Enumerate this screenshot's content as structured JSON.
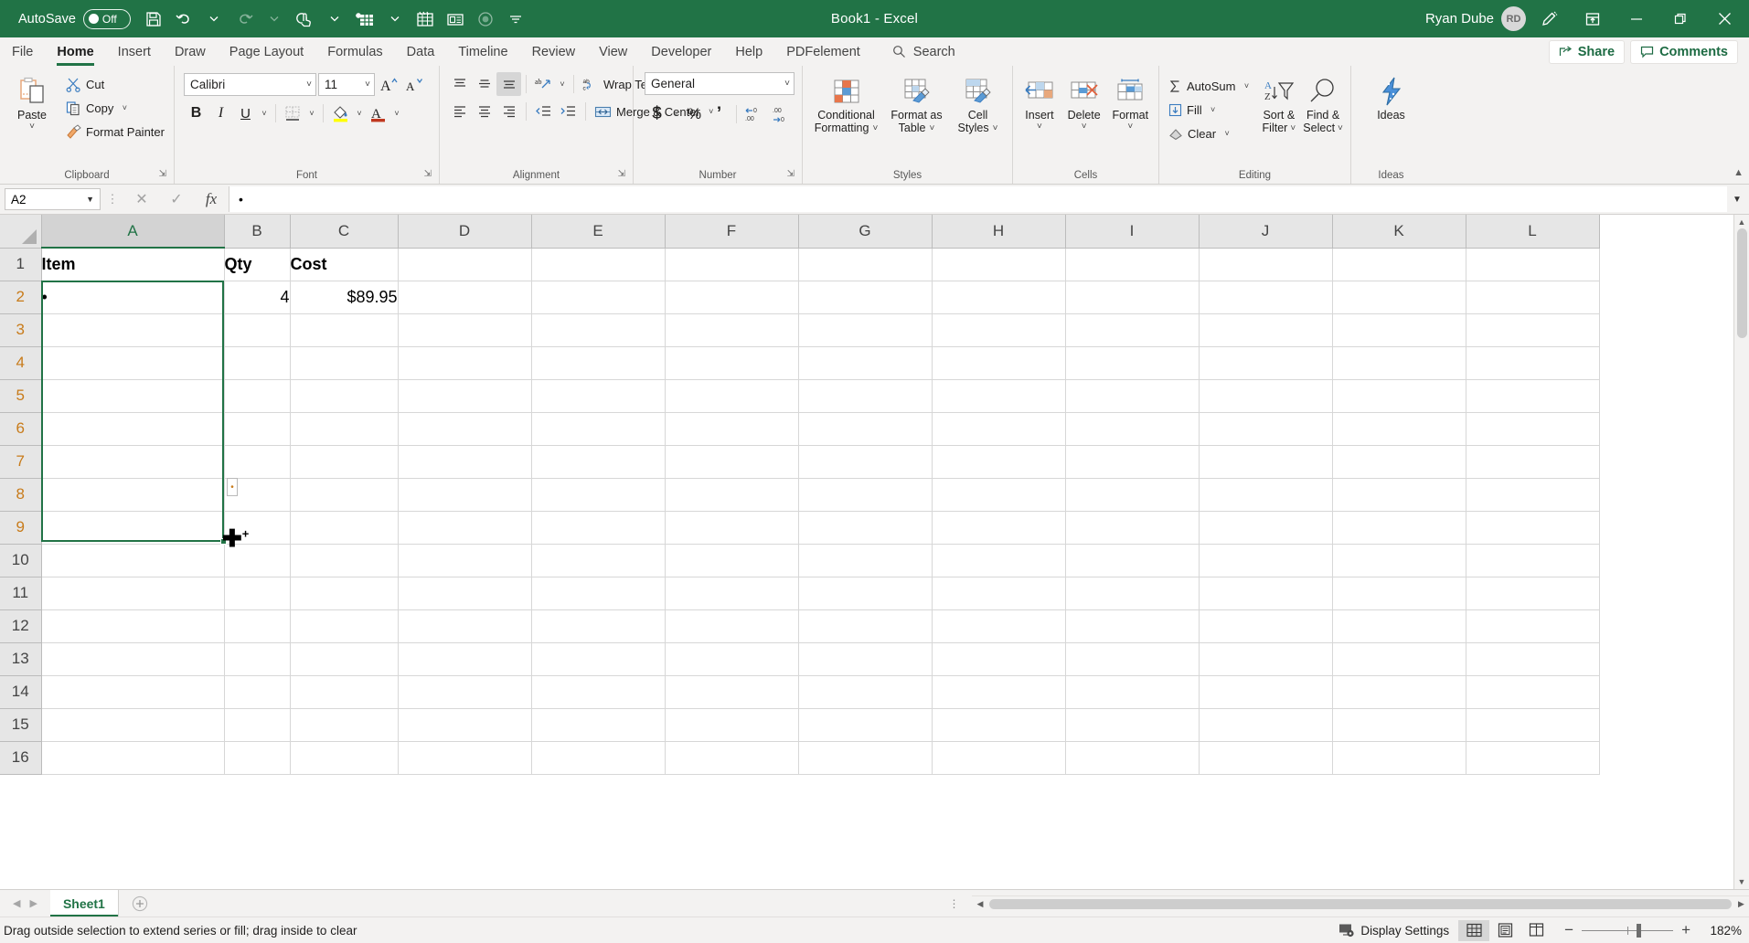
{
  "titlebar": {
    "autosave_label": "AutoSave",
    "autosave_state": "Off",
    "window_title": "Book1  -  Excel",
    "user_name": "Ryan Dube",
    "avatar_initials": "RD",
    "qat": [
      {
        "name": "save-icon",
        "label": "Save"
      },
      {
        "name": "undo-icon",
        "label": "Undo"
      },
      {
        "name": "redo-icon",
        "label": "Redo"
      },
      {
        "name": "touch-mode-icon",
        "label": "Touch/Mouse Mode"
      },
      {
        "name": "new-table-icon",
        "label": "Insert Table"
      },
      {
        "name": "spreadsheet-icon",
        "label": "Sheet Tools"
      },
      {
        "name": "form-icon",
        "label": "Form"
      },
      {
        "name": "record-icon",
        "label": "Record Macro"
      },
      {
        "name": "customize-qat-icon",
        "label": "Customize Quick Access Toolbar"
      }
    ],
    "window_controls": [
      "minimize",
      "restore",
      "close"
    ]
  },
  "tabs": {
    "items": [
      {
        "label": "File",
        "active": false
      },
      {
        "label": "Home",
        "active": true
      },
      {
        "label": "Insert",
        "active": false
      },
      {
        "label": "Draw",
        "active": false
      },
      {
        "label": "Page Layout",
        "active": false
      },
      {
        "label": "Formulas",
        "active": false
      },
      {
        "label": "Data",
        "active": false
      },
      {
        "label": "Timeline",
        "active": false
      },
      {
        "label": "Review",
        "active": false
      },
      {
        "label": "View",
        "active": false
      },
      {
        "label": "Developer",
        "active": false
      },
      {
        "label": "Help",
        "active": false
      },
      {
        "label": "PDFelement",
        "active": false
      }
    ],
    "search_placeholder": "Search",
    "share_label": "Share",
    "comments_label": "Comments"
  },
  "ribbon": {
    "clipboard": {
      "label": "Clipboard",
      "paste_label": "Paste",
      "cut_label": "Cut",
      "copy_label": "Copy",
      "format_painter_label": "Format Painter"
    },
    "font": {
      "label": "Font",
      "font_name": "Calibri",
      "font_size": "11",
      "grow_label": "A",
      "shrink_label": "A",
      "bold_label": "B",
      "italic_label": "I",
      "underline_label": "U"
    },
    "alignment": {
      "label": "Alignment",
      "wrap_text_label": "Wrap Text",
      "merge_center_label": "Merge & Center"
    },
    "number": {
      "label": "Number",
      "format": "General",
      "currency_label": "$",
      "percent_label": "%",
      "comma_label": "’"
    },
    "styles": {
      "label": "Styles",
      "conditional_formatting_label": "Conditional\nFormatting",
      "conditional_formatting_l1": "Conditional",
      "conditional_formatting_l2": "Formatting",
      "format_as_table_l1": "Format as",
      "format_as_table_l2": "Table",
      "cell_styles_l1": "Cell",
      "cell_styles_l2": "Styles"
    },
    "cells": {
      "label": "Cells",
      "insert_label": "Insert",
      "delete_label": "Delete",
      "format_label": "Format"
    },
    "editing": {
      "label": "Editing",
      "autosum_label": "AutoSum",
      "fill_label": "Fill",
      "clear_label": "Clear",
      "sort_filter_l1": "Sort &",
      "sort_filter_l2": "Filter",
      "find_select_l1": "Find &",
      "find_select_l2": "Select"
    },
    "ideas": {
      "label": "Ideas",
      "button_label": "Ideas"
    }
  },
  "formula_bar": {
    "name_box": "A2",
    "formula_value": "•",
    "cancel_icon": "✕",
    "enter_icon": "✓",
    "function_icon": "fx"
  },
  "grid": {
    "columns": [
      "A",
      "B",
      "C",
      "D",
      "E",
      "F",
      "G",
      "H",
      "I",
      "J",
      "K",
      "L"
    ],
    "selected_column": "A",
    "rows": [
      "1",
      "2",
      "3",
      "4",
      "5",
      "6",
      "7",
      "8",
      "9",
      "10",
      "11",
      "12",
      "13",
      "14",
      "15",
      "16"
    ],
    "selected_rows": [
      "2",
      "3",
      "4",
      "5",
      "6",
      "7",
      "8",
      "9"
    ],
    "cells": [
      {
        "row": "1",
        "A": "Item",
        "B": "Qty",
        "C": "Cost",
        "bold": true
      },
      {
        "row": "2",
        "A": "•",
        "B": "4",
        "C": "$89.95",
        "bold": false
      }
    ],
    "drag_tooltip": "•"
  },
  "sheet_bar": {
    "sheets": [
      {
        "label": "Sheet1",
        "active": true
      }
    ],
    "add_sheet_label": "+"
  },
  "status_bar": {
    "message": "Drag outside selection to extend series or fill; drag inside to clear",
    "display_settings_label": "Display Settings",
    "views": [
      {
        "name": "normal-view",
        "active": true
      },
      {
        "name": "page-layout-view",
        "active": false
      },
      {
        "name": "page-break-view",
        "active": false
      }
    ],
    "zoom_out_label": "−",
    "zoom_in_label": "+",
    "zoom_level": "182%"
  },
  "colors": {
    "brand_green": "#217346",
    "ribbon_bg": "#f3f2f1",
    "selection_border": "#217346",
    "header_bg": "#e6e6e6"
  }
}
